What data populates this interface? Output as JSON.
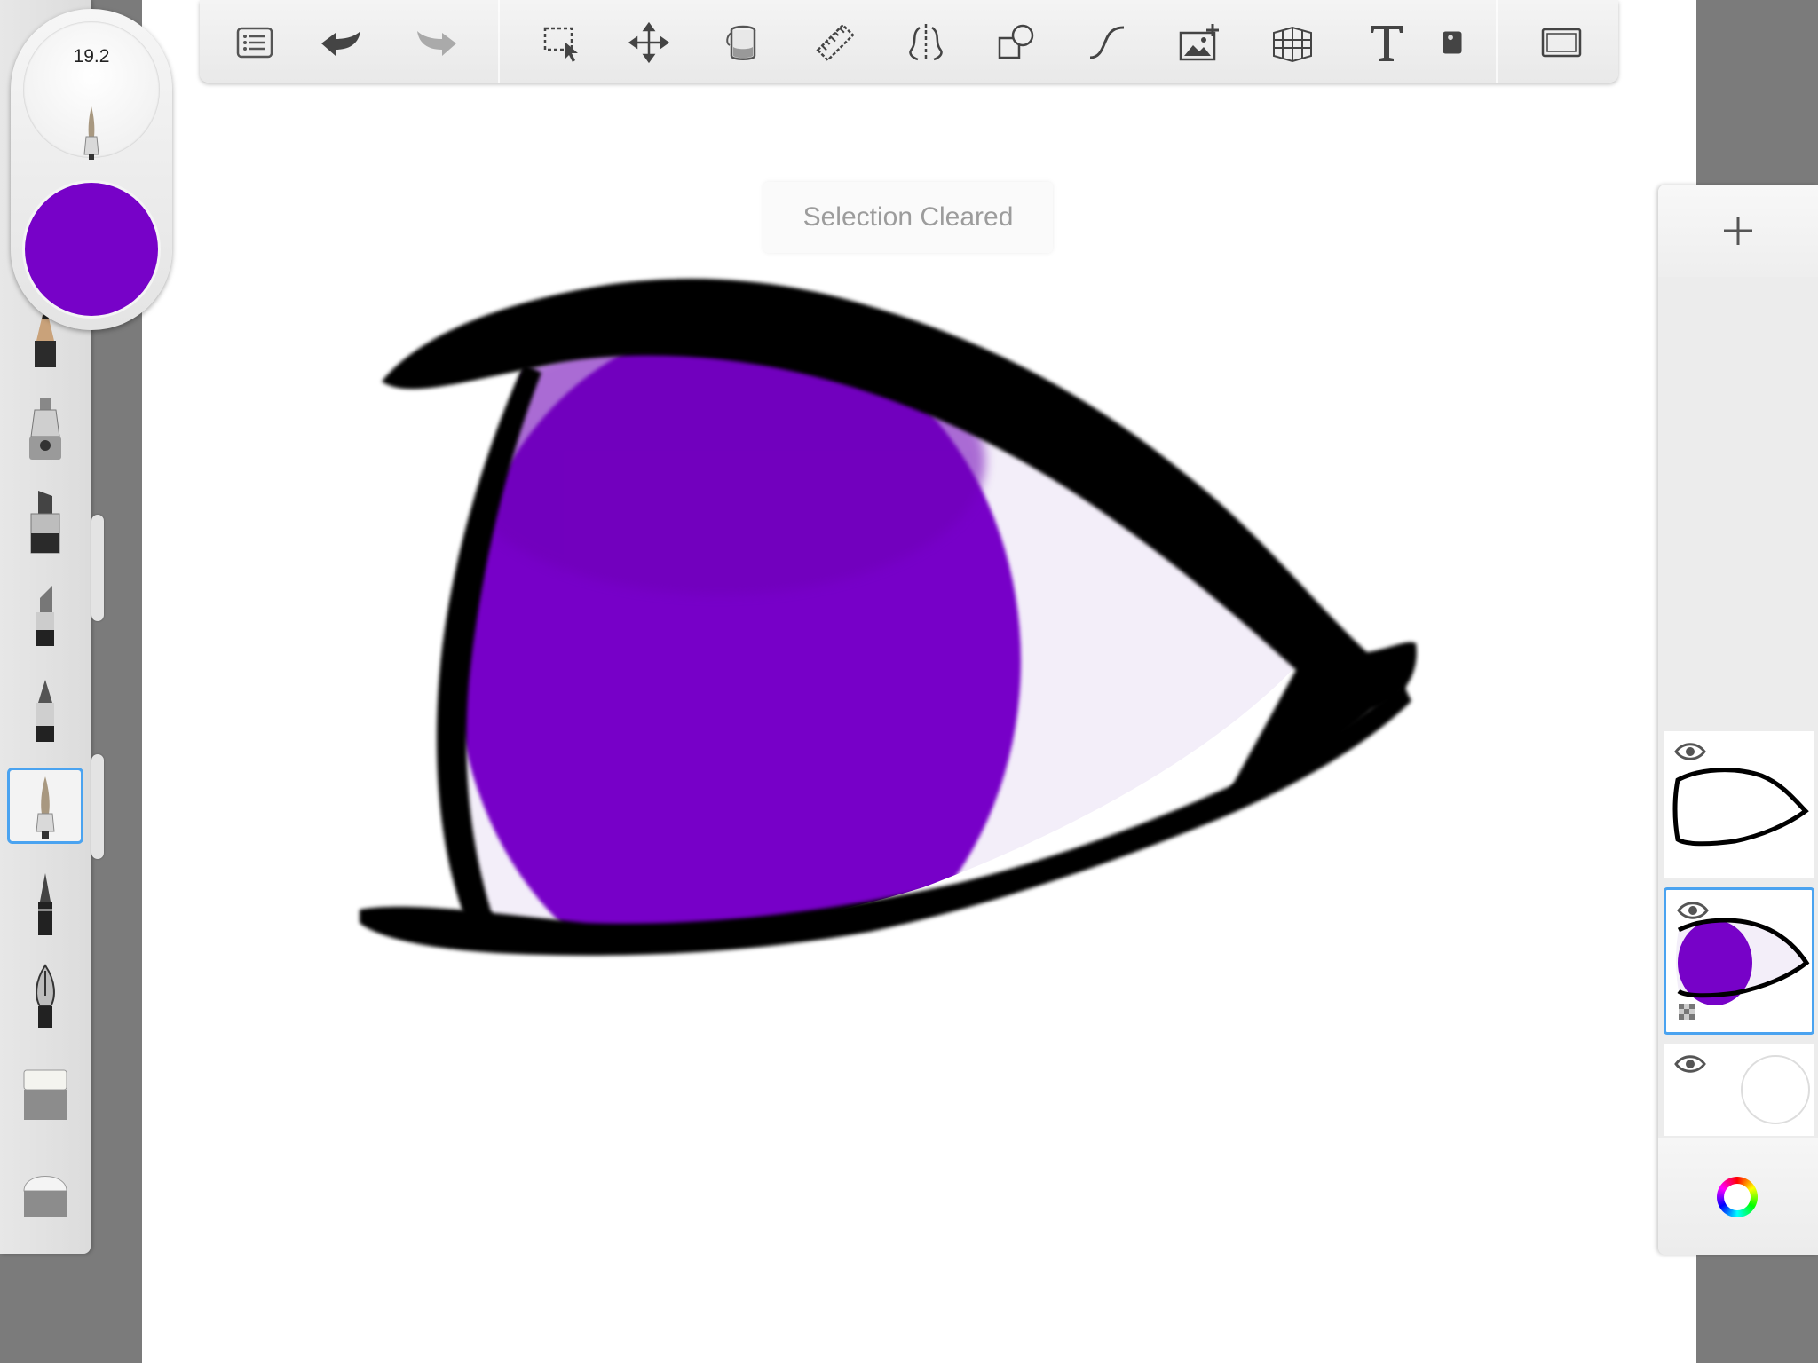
{
  "app": {
    "brush_size": "19.2",
    "current_color": "#7702c8",
    "toast": "Selection Cleared"
  },
  "toolbar": {
    "tools": [
      {
        "name": "menu-list-icon"
      },
      {
        "name": "undo-icon"
      },
      {
        "name": "redo-icon"
      },
      {
        "name": "selection-icon"
      },
      {
        "name": "transform-icon"
      },
      {
        "name": "fill-bucket-icon"
      },
      {
        "name": "ruler-icon"
      },
      {
        "name": "symmetry-icon"
      },
      {
        "name": "shapes-icon"
      },
      {
        "name": "curve-icon"
      },
      {
        "name": "add-image-icon"
      },
      {
        "name": "perspective-grid-icon"
      },
      {
        "name": "text-icon"
      },
      {
        "name": "stamp-icon"
      },
      {
        "name": "fullscreen-icon"
      }
    ]
  },
  "brushes": [
    {
      "name": "pencil-brush",
      "active": false
    },
    {
      "name": "airbrush-brush",
      "active": false
    },
    {
      "name": "marker-brush",
      "active": false
    },
    {
      "name": "chisel-marker-brush",
      "active": false
    },
    {
      "name": "ballpoint-pen-brush",
      "active": false
    },
    {
      "name": "paintbrush-brush",
      "active": true
    },
    {
      "name": "fineliner-brush",
      "active": false
    },
    {
      "name": "fountain-pen-brush",
      "active": false
    },
    {
      "name": "hard-eraser-brush",
      "active": false
    },
    {
      "name": "soft-eraser-brush",
      "active": false
    }
  ],
  "layers": [
    {
      "name": "layer-outline",
      "visible": true,
      "active": false
    },
    {
      "name": "layer-iris",
      "visible": true,
      "active": true
    },
    {
      "name": "layer-background",
      "visible": true,
      "active": false
    }
  ],
  "colors": {
    "accent": "#4aa3f0",
    "iris": "#7702c8",
    "eye_white": "#f3eef9",
    "ink": "#000000"
  }
}
